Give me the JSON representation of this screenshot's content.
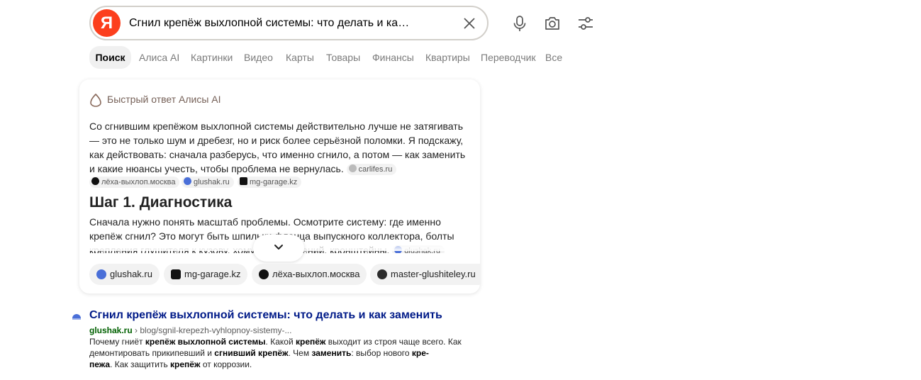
{
  "search": {
    "logo_letter": "Я",
    "query": "Сгнил крепёж выхлопной системы: что делать и как заменить"
  },
  "toolbar": {
    "icons": [
      "microphone-icon",
      "camera-icon",
      "settings-sliders-icon"
    ]
  },
  "tabs": [
    {
      "label": "Поиск",
      "active": true
    },
    {
      "label": "Алиса AI"
    },
    {
      "label": "Картинки"
    },
    {
      "label": "Видео"
    },
    {
      "label": "Карты"
    },
    {
      "label": "Товары"
    },
    {
      "label": "Финансы"
    },
    {
      "label": "Квартиры"
    },
    {
      "label": "Переводчик"
    },
    {
      "label": "Все"
    }
  ],
  "alice_card": {
    "title": "Быстрый ответ Алисы AI",
    "answer": "Со сгнившим крепёжом выхлопной системы действительно лучше не затягивать — это не только шум и дребезг, но и риск более серьёзной поломки. Я подскажу, как действовать: сначала разберусь, что именно сгнило, а потом — как заменить и какие нюансы учесть, чтобы проблема не вернулась.",
    "inline_sources": [
      "carlifes.ru",
      "лёха-выхлоп.москва",
      "glushak.ru",
      "mg-garage.kz"
    ],
    "step_title": "Шаг 1. Диагностика",
    "step_text": "Сначала нужно понять масштаб проблемы. Осмотрите систему: где именно крепёж сгнил? Это могут быть шпильки фланца выпускного коллектора, болты крепления глушителя к кузову, хомуты соединений, кронштейны.",
    "step_source": "glushak.ru",
    "sources": [
      {
        "label": "glushak.ru",
        "color": "#4a6fd8"
      },
      {
        "label": "mg-garage.kz",
        "color": "#111111"
      },
      {
        "label": "лёха-выхлоп.москва",
        "color": "#111111"
      },
      {
        "label": "master-glushiteley.ru",
        "color": "#2b2b2b"
      }
    ]
  },
  "result": {
    "title": "Сгнил крепёж выхлопной системы: что делать и как заменить",
    "host": "glushak.ru",
    "path": "› blog/sgnil-krepezh-vyhlopnoy-sistemy-...",
    "snippet": {
      "s1": "Почему гниёт ",
      "b1": "крепёж выхлопной системы",
      "s2": ". Какой ",
      "b2": "крепёж",
      "s3": " выходит из строя чаще всего. Как демонтировать прикипевший и ",
      "b3": "сгнивший крепёж",
      "s4": ". Чем ",
      "b4": "заменить",
      "s5": ": выбор нового ",
      "b5": "кре-",
      "b6": "пежа",
      "s6": ". Как защитить ",
      "b7": "крепёж",
      "s7": " от коррозии."
    }
  }
}
